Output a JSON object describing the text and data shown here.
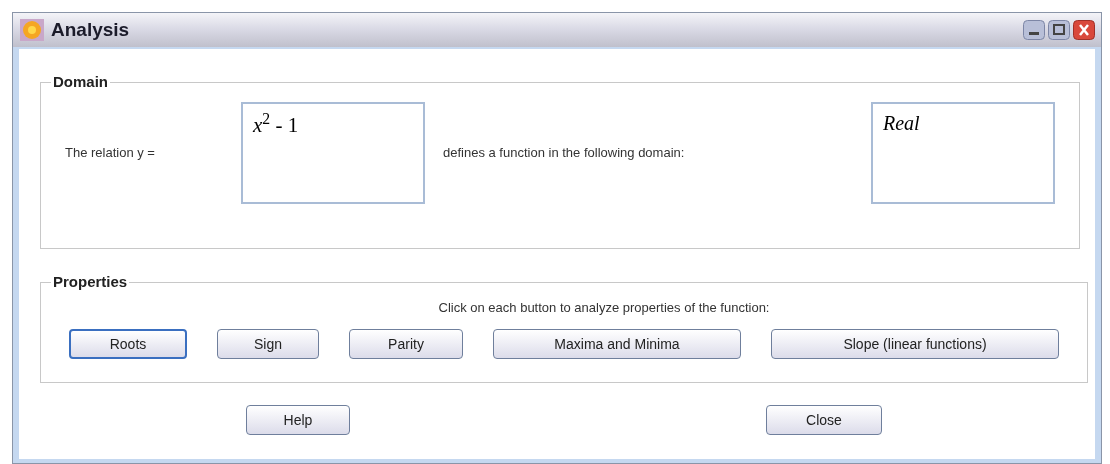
{
  "window": {
    "title": "Analysis"
  },
  "domain": {
    "legend": "Domain",
    "relation_label": "The relation y =",
    "relation_value": "*x*$^{2}$ - 1",
    "domain_label": "defines a function in the following domain:",
    "domain_value": "Real"
  },
  "properties": {
    "legend": "Properties",
    "instruction": "Click on each button to analyze properties of the function:",
    "buttons": [
      {
        "label": "Roots",
        "focused": true
      },
      {
        "label": "Sign",
        "focused": false
      },
      {
        "label": "Parity",
        "focused": false
      },
      {
        "label": "Maxima and Minima",
        "focused": false
      },
      {
        "label": "Slope (linear functions)",
        "focused": false
      }
    ]
  },
  "footer_buttons": [
    "Help",
    "Close"
  ]
}
